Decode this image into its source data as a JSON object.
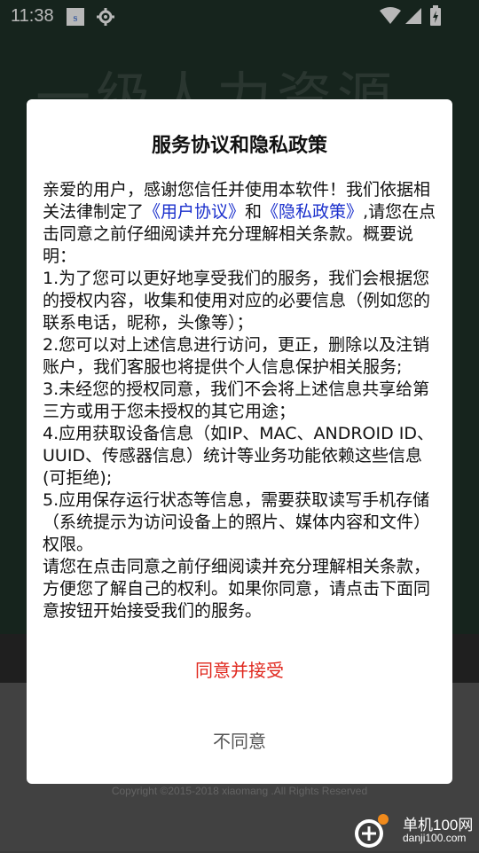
{
  "status_bar": {
    "time": "11:38"
  },
  "background": {
    "title": "一级人力资源",
    "copyright": "Copyright ©2015-2018 xiaomang .All Rights Reserved"
  },
  "dialog": {
    "title": "服务协议和隐私政策",
    "p1_a": "亲爱的用户，感谢您信任并使用本软件！我们依据相关法律制定了",
    "link_user": "《用户协议》",
    "p1_and": "和",
    "link_privacy": "《隐私政策》",
    "p1_b": ",请您在点击同意之前仔细阅读并充分理解相关条款。概要说明：",
    "item1": "1.为了您可以更好地享受我们的服务，我们会根据您的授权内容，收集和使用对应的必要信息（例如您的联系电话，昵称，头像等）；",
    "item2": "2.您可以对上述信息进行访问，更正，删除以及注销账户，我们客服也将提供个人信息保护相关服务;",
    "item3": "3.未经您的授权同意，我们不会将上述信息共享给第三方或用于您未授权的其它用途；",
    "item4": "4.应用获取设备信息（如IP、MAC、ANDROID ID、UUID、传感器信息）统计等业务功能依赖这些信息(可拒绝);",
    "item5": "5.应用保存运行状态等信息，需要获取读写手机存储（系统提示为访问设备上的照片、媒体内容和文件）权限。",
    "closing": "请您在点击同意之前仔细阅读并充分理解相关条款，方便您了解自己的权利。如果你同意，请点击下面同意按钮开始接受我们的服务。",
    "agree_label": "同意并接受",
    "disagree_label": "不同意"
  },
  "watermark": {
    "name": "单机100网",
    "domain": "danji100.com"
  },
  "colors": {
    "link": "#1a2fcc",
    "agree": "#e0281e",
    "disagree": "#555555"
  }
}
